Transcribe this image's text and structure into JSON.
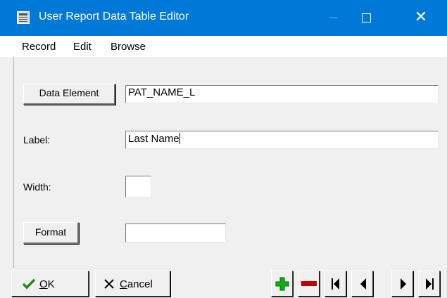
{
  "window": {
    "title": "User Report Data Table Editor"
  },
  "menu": {
    "items": [
      "Record",
      "Edit",
      "Browse"
    ]
  },
  "form": {
    "data_element_button": "Data Element",
    "data_element_value": "PAT_NAME_L",
    "label_label": "Label:",
    "label_value": "Last Name",
    "width_label": "Width:",
    "width_value": "",
    "format_button": "Format",
    "format_value": ""
  },
  "buttons": {
    "ok_accel": "O",
    "ok_rest": "K",
    "cancel_accel": "C",
    "cancel_rest": "ancel"
  },
  "icons": {
    "ok": "check-icon",
    "cancel": "x-icon",
    "add": "plus-icon",
    "delete": "minus-icon",
    "first": "first-record-icon",
    "prev": "prev-record-icon",
    "next": "next-record-icon",
    "last": "last-record-icon"
  },
  "colors": {
    "titlebar": "#0078d7",
    "ok_check": "#1e8c1e",
    "add_plus": "#11b011",
    "delete_minus": "#c00000"
  }
}
